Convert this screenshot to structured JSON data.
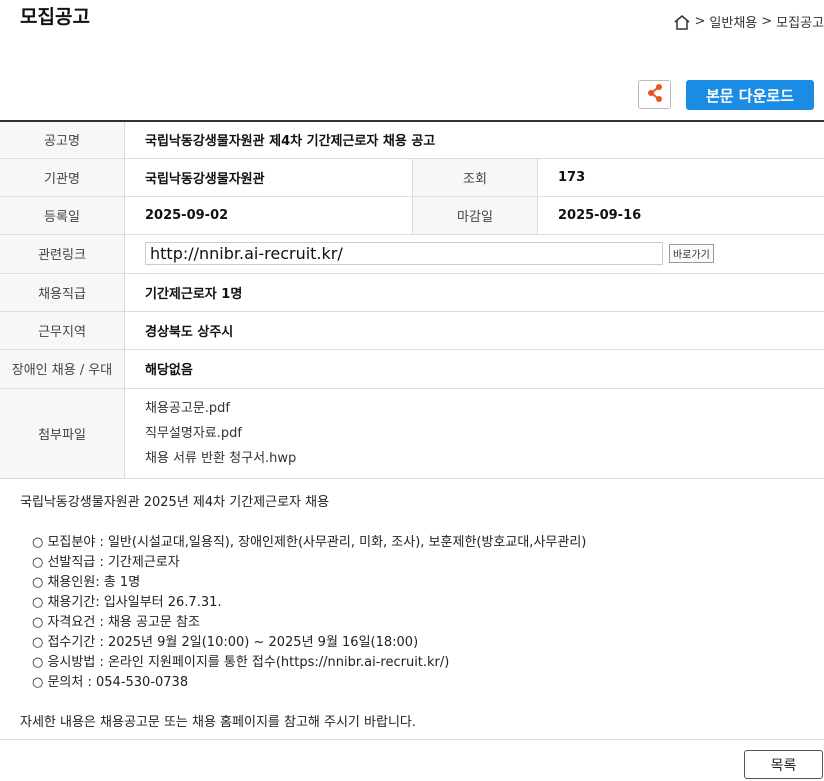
{
  "page_title": "모집공고",
  "breadcrumb": {
    "sep1": ">",
    "item1": "일반채용",
    "sep2": ">",
    "item2": "모집공고"
  },
  "buttons": {
    "download": "본문 다운로드",
    "list": "목록",
    "go": "바로가기"
  },
  "info": {
    "title_label": "공고명",
    "title_value": "국립낙동강생물자원관 제4차 기간제근로자 채용 공고",
    "org_label": "기관명",
    "org_value": "국립낙동강생물자원관",
    "views_label": "조회",
    "views_value": "173",
    "reg_label": "등록일",
    "reg_value": "2025-09-02",
    "deadline_label": "마감일",
    "deadline_value": "2025-09-16",
    "link_label": "관련링크",
    "link_value": "http://nnibr.ai-recruit.kr/",
    "rank_label": "채용직급",
    "rank_value": "기간제근로자 1명",
    "region_label": "근무지역",
    "region_value": "경상북도 상주시",
    "disabled_label": "장애인 채용 / 우대",
    "disabled_value": "해당없음",
    "files_label": "첨부파일",
    "files": [
      "채용공고문.pdf",
      "직무설명자료.pdf",
      "채용 서류 반환 청구서.hwp"
    ]
  },
  "body": {
    "intro": "국립낙동강생물자원관 2025년 제4차 기간제근로자 채용",
    "bullets": [
      "○ 모집분야 : 일반(시설교대,일용직), 장애인제한(사무관리, 미화, 조사), 보훈제한(방호교대,사무관리)",
      "○ 선발직급 : 기간제근로자",
      "○ 채용인원: 총 1명",
      "○ 채용기간: 입사일부터 26.7.31.",
      "○ 자격요건 : 채용 공고문 참조",
      "○ 접수기간 : 2025년 9월 2일(10:00) ~ 2025년 9월 16일(18:00)",
      "○ 응시방법 : 온라인 지원페이지를 통한 접수(https://nnibr.ai-recruit.kr/)",
      "○ 문의처 : 054-530-0738"
    ],
    "outro": "자세한 내용은 채용공고문 또는 채용 홈페이지를 참고해 주시기 바랍니다."
  }
}
